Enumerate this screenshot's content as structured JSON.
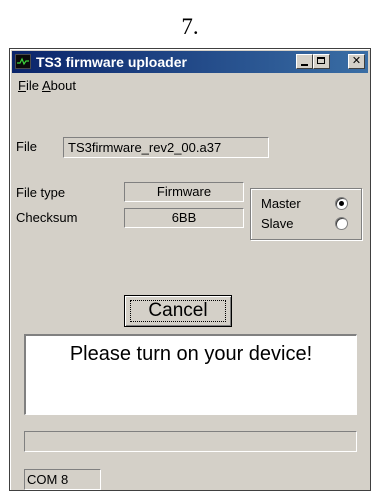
{
  "caption": "7.",
  "window": {
    "title": "TS3 firmware uploader",
    "controls": {
      "minimize": "_",
      "close": "✕"
    }
  },
  "menu": [
    {
      "label": "File",
      "mnemonic": "F",
      "rest": "ile"
    },
    {
      "label": "About",
      "mnemonic": "A",
      "rest": "bout"
    }
  ],
  "form": {
    "file_label": "File",
    "file_value": "TS3firmware_rev2_00.a37",
    "filetype_label": "File type",
    "filetype_value": "Firmware",
    "checksum_label": "Checksum",
    "checksum_value": "6BB"
  },
  "mode": {
    "options": [
      {
        "label": "Master",
        "selected": true
      },
      {
        "label": "Slave",
        "selected": false
      }
    ]
  },
  "cancel_label": "Cancel",
  "message": "Please turn on your device!",
  "progress": 0,
  "status": "COM 8",
  "colors": {
    "titlebar": "#0a246a",
    "face": "#d4d0c8"
  }
}
